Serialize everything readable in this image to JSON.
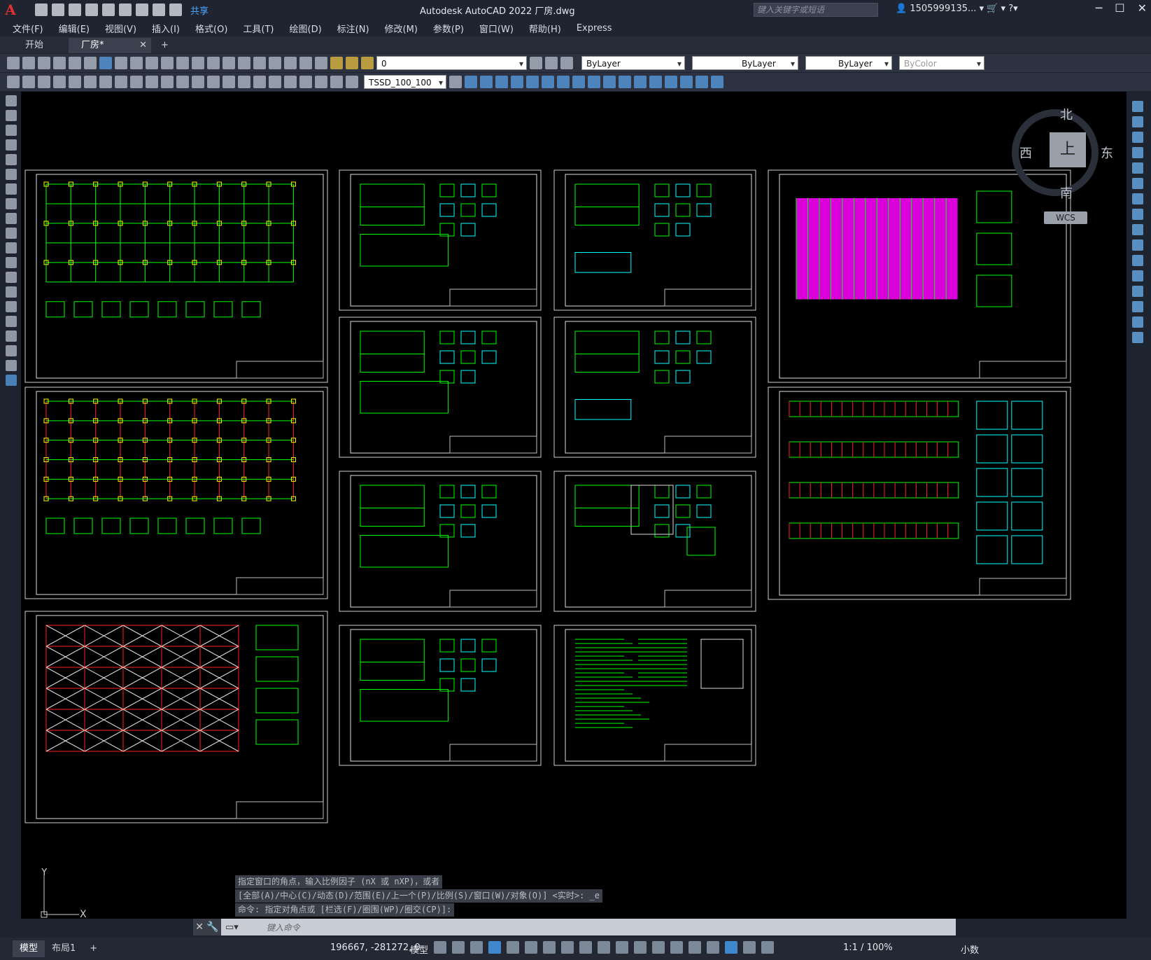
{
  "window": {
    "title": "Autodesk AutoCAD 2022    厂房.dwg",
    "search_placeholder": "键入关键字或短语",
    "user": "1505999135...",
    "share_label": "共享"
  },
  "menu": [
    "文件(F)",
    "编辑(E)",
    "视图(V)",
    "插入(I)",
    "格式(O)",
    "工具(T)",
    "绘图(D)",
    "标注(N)",
    "修改(M)",
    "参数(P)",
    "窗口(W)",
    "帮助(H)",
    "Express"
  ],
  "doc_tabs": [
    {
      "label": "开始",
      "active": false
    },
    {
      "label": "厂房*",
      "active": true
    }
  ],
  "toolbar": {
    "layer_value": "0",
    "color_value": "ByLayer",
    "linetype_value": "ByLayer",
    "lineweight_value": "ByLayer",
    "plotstyle_value": "ByColor",
    "dimstyle_value": "TSSD_100_100"
  },
  "viewcube": {
    "north": "北",
    "south": "南",
    "west": "西",
    "east": "东",
    "face": "上",
    "wcs": "WCS"
  },
  "ucs": {
    "y": "Y",
    "x": "X"
  },
  "command": {
    "history": [
      "指定窗口的角点，输入比例因子 (nX 或 nXP)，或者",
      "[全部(A)/中心(C)/动态(D)/范围(E)/上一个(P)/比例(S)/窗口(W)/对象(O)] <实时>: _e",
      "命令: 指定对角点或 [栏选(F)/圈围(WP)/圈交(CP)]:"
    ],
    "placeholder": "键入命令"
  },
  "status": {
    "tabs": [
      {
        "label": "模型",
        "active": true
      },
      {
        "label": "布局1",
        "active": false
      }
    ],
    "coords": "196667, -281272, 0",
    "model": "模型",
    "scale": "1:1 / 100%",
    "units": "小数"
  },
  "colors": {
    "canvas": "#000000",
    "green": "#00ff00",
    "magenta": "#ff00ff",
    "red": "#ff2020",
    "yellow": "#ffff00",
    "cyan": "#00ffff"
  }
}
